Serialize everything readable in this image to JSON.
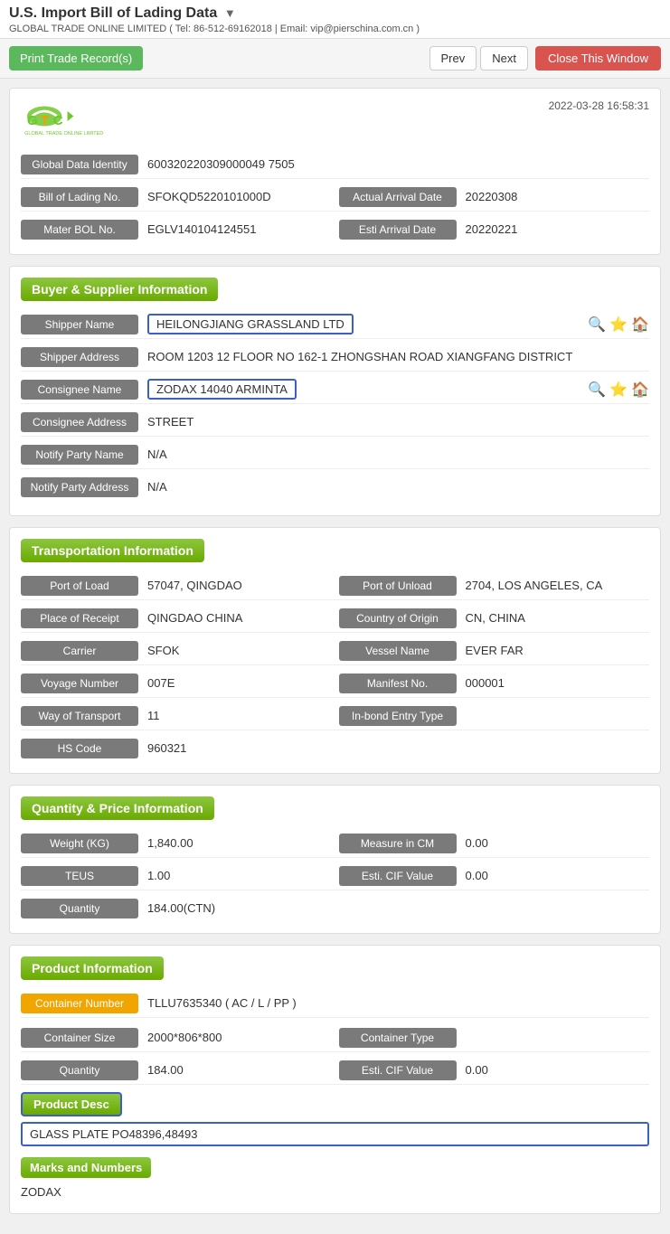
{
  "page": {
    "title": "U.S. Import Bill of Lading Data",
    "dropdown_arrow": "▼",
    "subtitle": "GLOBAL TRADE ONLINE LIMITED ( Tel: 86-512-69162018 | Email: vip@pierschina.com.cn )"
  },
  "toolbar": {
    "print_label": "Print Trade Record(s)",
    "prev_label": "Prev",
    "next_label": "Next",
    "close_label": "Close This Window"
  },
  "card_main": {
    "timestamp": "2022-03-28 16:58:31",
    "fields": {
      "global_data_identity_label": "Global Data Identity",
      "global_data_identity_value": "600320220309000049 7505",
      "bill_of_lading_label": "Bill of Lading No.",
      "bill_of_lading_value": "SFOKQD5220101000D",
      "actual_arrival_label": "Actual Arrival Date",
      "actual_arrival_value": "20220308",
      "mater_bol_label": "Mater BOL No.",
      "mater_bol_value": "EGLV140104124551",
      "esti_arrival_label": "Esti Arrival Date",
      "esti_arrival_value": "20220221"
    }
  },
  "buyer_supplier": {
    "section_title": "Buyer & Supplier Information",
    "shipper_name_label": "Shipper Name",
    "shipper_name_value": "HEILONGJIANG GRASSLAND LTD",
    "shipper_address_label": "Shipper Address",
    "shipper_address_value": "ROOM 1203 12 FLOOR NO 162-1 ZHONGSHAN ROAD XIANGFANG DISTRICT",
    "consignee_name_label": "Consignee Name",
    "consignee_name_value": "ZODAX 14040 ARMINTA",
    "consignee_address_label": "Consignee Address",
    "consignee_address_value": "STREET",
    "notify_party_name_label": "Notify Party Name",
    "notify_party_name_value": "N/A",
    "notify_party_address_label": "Notify Party Address",
    "notify_party_address_value": "N/A"
  },
  "transportation": {
    "section_title": "Transportation Information",
    "port_of_load_label": "Port of Load",
    "port_of_load_value": "57047, QINGDAO",
    "port_of_unload_label": "Port of Unload",
    "port_of_unload_value": "2704, LOS ANGELES, CA",
    "place_of_receipt_label": "Place of Receipt",
    "place_of_receipt_value": "QINGDAO CHINA",
    "country_of_origin_label": "Country of Origin",
    "country_of_origin_value": "CN, CHINA",
    "carrier_label": "Carrier",
    "carrier_value": "SFOK",
    "vessel_name_label": "Vessel Name",
    "vessel_name_value": "EVER FAR",
    "voyage_number_label": "Voyage Number",
    "voyage_number_value": "007E",
    "manifest_label": "Manifest No.",
    "manifest_value": "000001",
    "way_of_transport_label": "Way of Transport",
    "way_of_transport_value": "11",
    "in_bond_label": "In-bond Entry Type",
    "in_bond_value": "",
    "hs_code_label": "HS Code",
    "hs_code_value": "960321"
  },
  "quantity_price": {
    "section_title": "Quantity & Price Information",
    "weight_label": "Weight (KG)",
    "weight_value": "1,840.00",
    "measure_label": "Measure in CM",
    "measure_value": "0.00",
    "teus_label": "TEUS",
    "teus_value": "1.00",
    "esti_cif_label": "Esti. CIF Value",
    "esti_cif_value": "0.00",
    "quantity_label": "Quantity",
    "quantity_value": "184.00(CTN)"
  },
  "product_info": {
    "section_title": "Product Information",
    "container_number_label": "Container Number",
    "container_number_value": "TLLU7635340 ( AC / L / PP )",
    "container_size_label": "Container Size",
    "container_size_value": "2000*806*800",
    "container_type_label": "Container Type",
    "container_type_value": "",
    "quantity_label": "Quantity",
    "quantity_value": "184.00",
    "esti_cif_label": "Esti. CIF Value",
    "esti_cif_value": "0.00",
    "product_desc_label": "Product Desc",
    "product_desc_value": "GLASS PLATE PO48396,48493",
    "marks_label": "Marks and Numbers",
    "marks_value": "ZODAX"
  }
}
